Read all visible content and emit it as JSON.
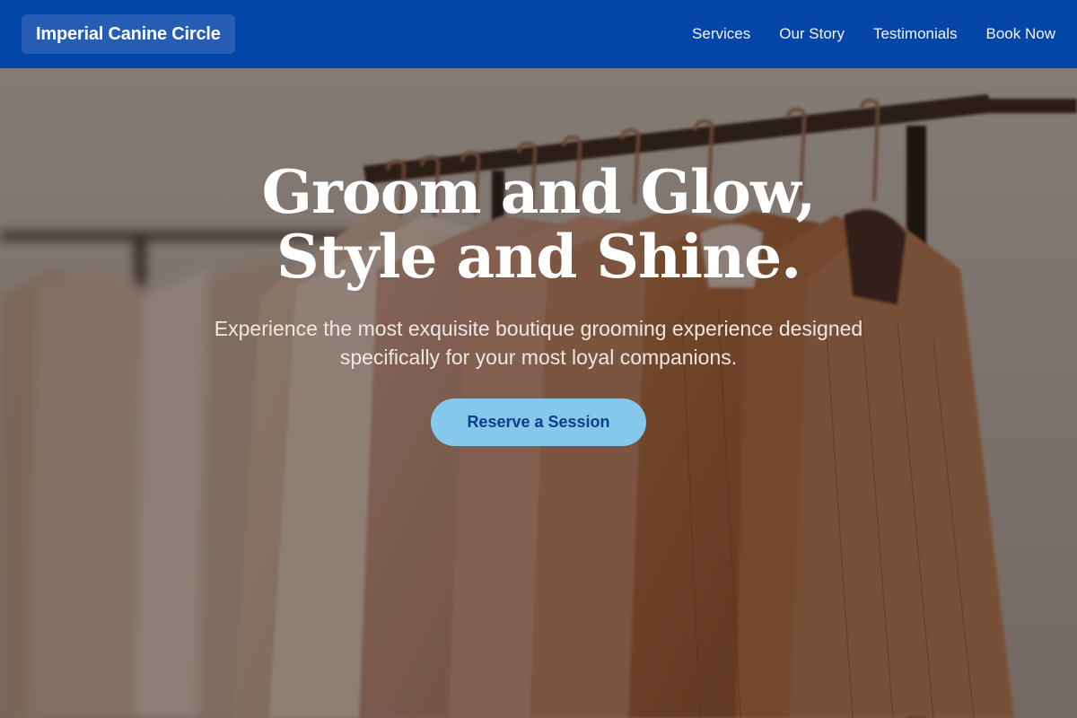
{
  "navbar": {
    "brand": "Imperial Canine Circle",
    "links": [
      "Services",
      "Our Story",
      "Testimonials",
      "Book Now"
    ]
  },
  "hero": {
    "headline_line1": "Groom and Glow,",
    "headline_line2": "Style and Shine.",
    "subtext": "Experience the most exquisite boutique grooming experience designed specifically for your most loyal companions.",
    "cta_label": "Reserve a Session",
    "background_icon": "clothing-rack-photo"
  },
  "colors": {
    "navbar": "#0446a8",
    "cta_background": "#86c8ec",
    "cta_text": "#0b3d8f"
  }
}
